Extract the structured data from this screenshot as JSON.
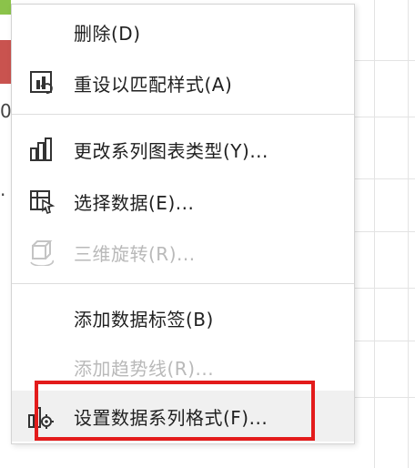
{
  "colors": {
    "highlight_box": "#e31b1b",
    "swatch_green": "#8bc34a",
    "swatch_red": "#c9534f",
    "disabled_text": "#b9b9b9"
  },
  "background": {
    "fragment_top": "0",
    "fragment_bottom": "."
  },
  "menu": {
    "items": [
      {
        "label": "删除(D)",
        "icon": "none",
        "enabled": true
      },
      {
        "label": "重设以匹配样式(A)",
        "icon": "reset-style-icon",
        "enabled": true
      },
      {
        "label": "更改系列图表类型(Y)...",
        "icon": "bar-chart-icon",
        "enabled": true
      },
      {
        "label": "选择数据(E)...",
        "icon": "select-data-icon",
        "enabled": true
      },
      {
        "label": "三维旋转(R)...",
        "icon": "3d-rotate-icon",
        "enabled": false
      },
      {
        "label": "添加数据标签(B)",
        "icon": "none",
        "enabled": true
      },
      {
        "label": "添加趋势线(R)...",
        "icon": "none",
        "enabled": false
      },
      {
        "label": "设置数据系列格式(F)...",
        "icon": "format-series-icon",
        "enabled": true,
        "hovered": true
      }
    ]
  }
}
